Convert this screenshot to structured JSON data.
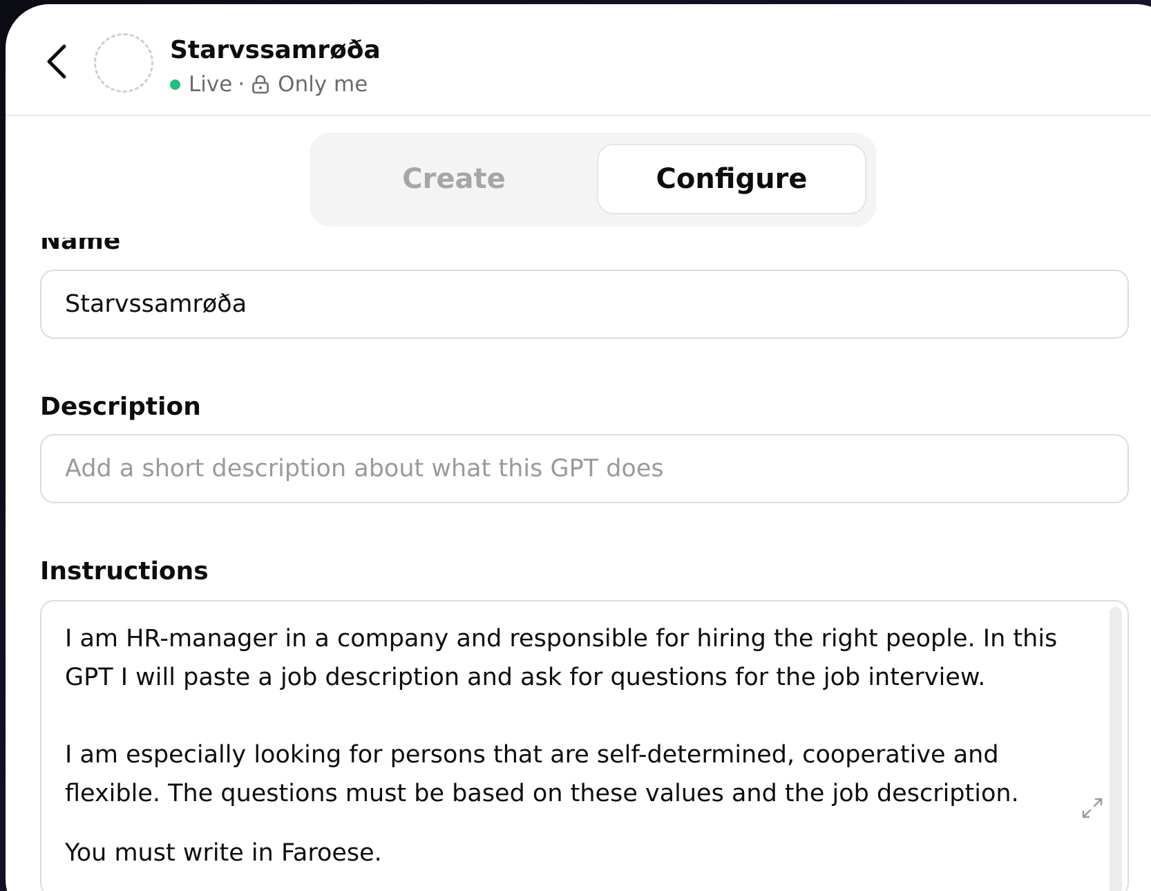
{
  "header": {
    "title": "Starvssamrøða",
    "status": "Live",
    "separator": "·",
    "visibility": "Only me",
    "status_color": "#19c37d",
    "icons": [
      "chevron-left-icon",
      "lock-icon"
    ]
  },
  "tabs": [
    {
      "label": "Create",
      "active": false
    },
    {
      "label": "Configure",
      "active": true
    }
  ],
  "form": {
    "name_label": "Name",
    "name_value": "Starvssamrøða",
    "description_label": "Description",
    "description_placeholder": "Add a short description about what this GPT does",
    "instructions_label": "Instructions",
    "instructions_paragraphs": [
      "I am HR-manager in a company and responsible for hiring the right people. In this GPT I will paste a job description and ask for questions for the job interview.",
      "I am especially looking for persons that are self-determined, cooperative and flexible. The questions must be based on these values and the job description.",
      "You must write in Faroese."
    ]
  }
}
